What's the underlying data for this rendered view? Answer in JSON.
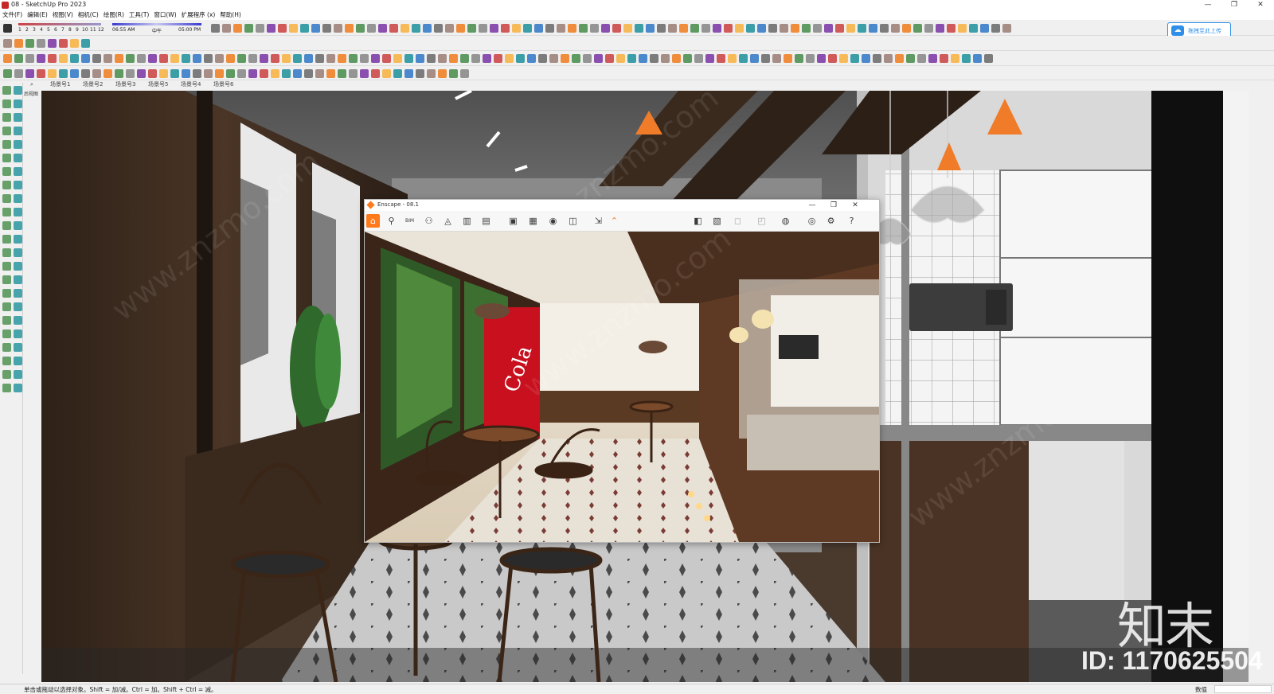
{
  "window": {
    "title": "08 - SketchUp Pro 2023",
    "controls": [
      "—",
      "❐",
      "✕"
    ]
  },
  "menu": [
    "文件(F)",
    "编辑(E)",
    "视图(V)",
    "相机(C)",
    "绘图(R)",
    "工具(T)",
    "窗口(W)",
    "扩展程序 (x)",
    "帮助(H)"
  ],
  "shadow_settings": {
    "months": [
      "1",
      "2",
      "3",
      "4",
      "5",
      "6",
      "7",
      "8",
      "9",
      "10",
      "11",
      "12"
    ],
    "time_start": "06:55 AM",
    "time_mid": "中午",
    "time_end": "05:00 PM"
  },
  "upload_button": {
    "label": "拖拽至此上传",
    "icon": "cloud-upload-icon",
    "color": "#2f8fe8"
  },
  "scenes": [
    "场景号1",
    "场景号2",
    "场景号3",
    "场景号5",
    "场景号4",
    "场景号6"
  ],
  "viewport": {
    "view_label": "后视图"
  },
  "enscape": {
    "title": "Enscape - 08.1",
    "accent": "#ff7a1a",
    "toolbar_icons": [
      "home-icon",
      "asset-library-icon",
      "bim-icon",
      "views-icon",
      "material-icon",
      "sun-icon",
      "video-editor-icon",
      "screenshot-icon",
      "batch-render-icon",
      "web-standalone-icon",
      "panorama-icon",
      "export-icon",
      "collapse-icon",
      "site-context-icon",
      "minimap-icon",
      "settings-icon",
      "visual-settings-icon",
      "help-icon"
    ],
    "bim_label": "BIM"
  },
  "statusbar": {
    "hint": "单击或拖动以选择对象。Shift = 加/减。Ctrl = 加。Shift + Ctrl = 减。",
    "measure_label": "数值"
  },
  "watermark": {
    "logo": "知末",
    "id_text": "ID: 1170625504",
    "diagonal": "www.znzmo.com"
  }
}
